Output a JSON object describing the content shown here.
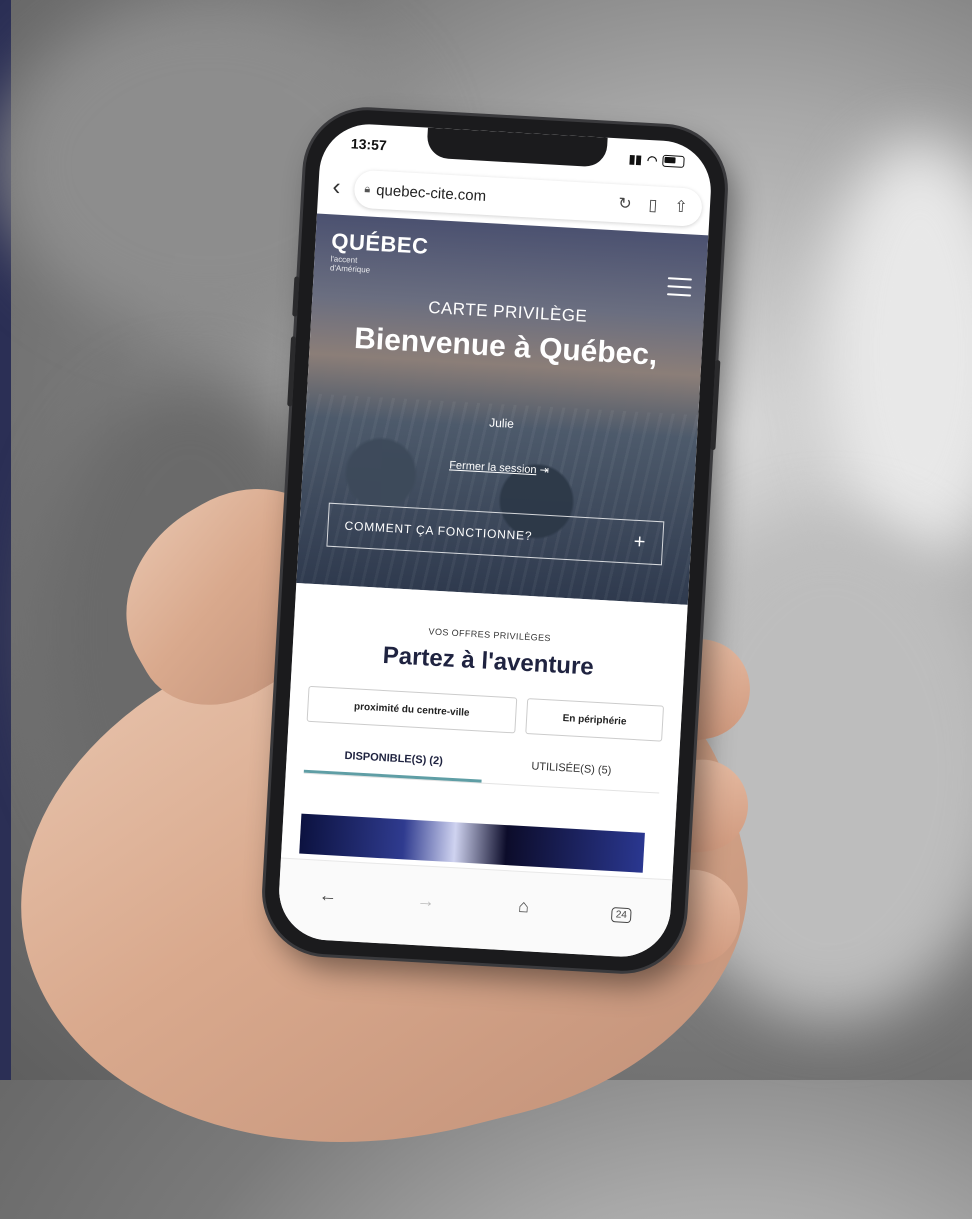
{
  "status": {
    "time": "13:57"
  },
  "browser": {
    "url": "quebec-cite.com",
    "icons": {
      "back": "chevron-left-icon",
      "lock": "lock-icon",
      "reload": "reload-icon",
      "bookmark": "bookmark-icon",
      "share": "share-icon"
    }
  },
  "hero": {
    "logo": "QUÉBEC",
    "logo_tagline_1": "l'accent",
    "logo_tagline_2": "d'Amérique",
    "kicker": "CARTE PRIVILÈGE",
    "title": "Bienvenue à Québec,",
    "name": "Julie",
    "logout": "Fermer la session",
    "how_button": "COMMENT ÇA FONCTIONNE?"
  },
  "offers": {
    "kicker": "VOS OFFRES PRIVILÈGES",
    "title": "Partez à l'aventure",
    "filters": [
      "proximité du centre-ville",
      "En périphérie"
    ],
    "tabs": [
      "DISPONIBLE(S) (2)",
      "UTILISÉE(S) (5)"
    ]
  },
  "bottom_nav": {
    "tabs_count": "24"
  }
}
